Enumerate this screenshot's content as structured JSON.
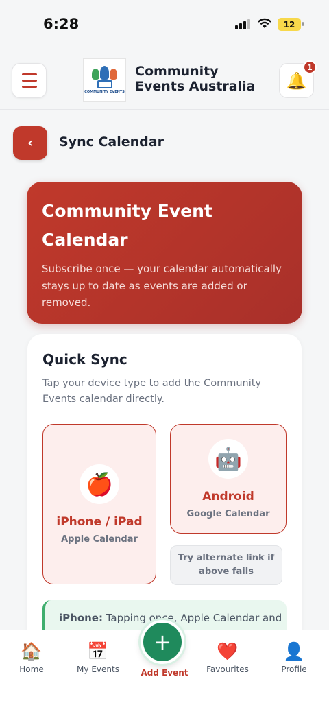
{
  "status_bar": {
    "time": "6:28",
    "battery": "12"
  },
  "header": {
    "logo_text": "COMMUNITY EVENTS",
    "brand_line1": "Community",
    "brand_line2": "Events Australia",
    "notification_count": "1"
  },
  "page": {
    "title": "Sync Calendar"
  },
  "hero": {
    "title_line1": "Community Event",
    "title_line2": "Calendar",
    "subtitle": "Subscribe once — your calendar automatically stays up to date as events are added or removed."
  },
  "quick_sync": {
    "title": "Quick Sync",
    "subtitle": "Tap your device type to add the Community Events calendar directly.",
    "devices": [
      {
        "name": "iPhone / iPad",
        "app": "Apple Calendar",
        "icon": "🍎"
      },
      {
        "name": "Android",
        "app": "Google Calendar",
        "icon": "🤖"
      }
    ],
    "alternate_link": "Try alternate link if above fails",
    "note_bold": "iPhone:",
    "note_text": " Tapping once, Apple Calendar and"
  },
  "bottom_nav": {
    "items": [
      {
        "label": "Home",
        "icon": "🏠"
      },
      {
        "label": "My Events",
        "icon": "📅"
      },
      {
        "label": "Favourites",
        "icon": "❤️"
      },
      {
        "label": "Profile",
        "icon": "👤"
      }
    ],
    "add_label": "Add Event",
    "add_icon": "+"
  },
  "colors": {
    "accent": "#c0392b",
    "green": "#1f8a5c"
  }
}
